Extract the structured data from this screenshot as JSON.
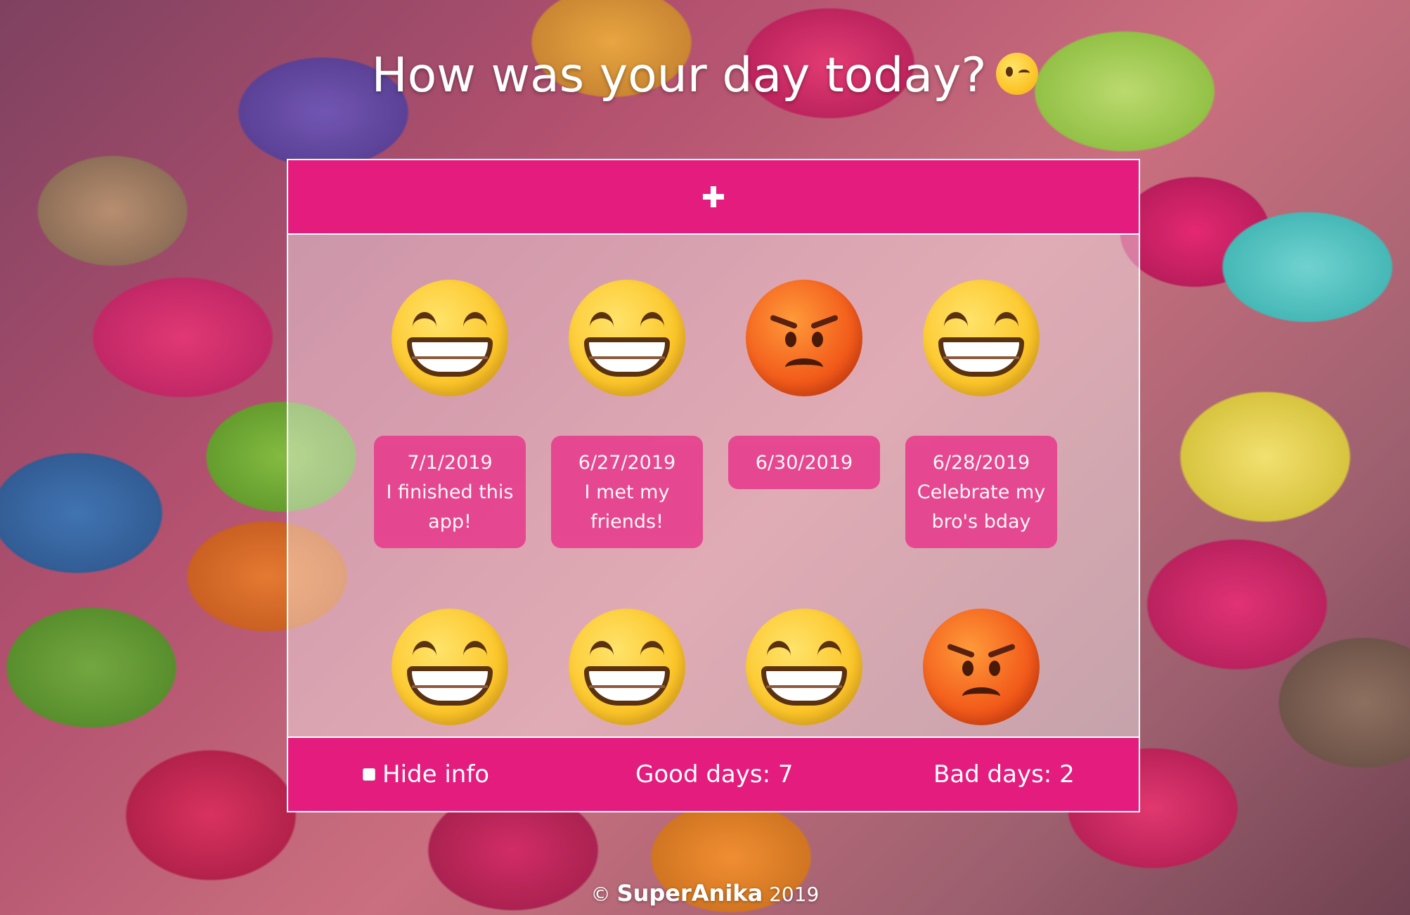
{
  "header": {
    "title": "How was your day today?",
    "title_icon": "wink-emoji-icon"
  },
  "add_button": {
    "icon": "plus-icon"
  },
  "days": [
    {
      "mood": "happy",
      "icon": "grinning-face-icon",
      "date": "7/1/2019",
      "note": "I finished this app!"
    },
    {
      "mood": "happy",
      "icon": "grinning-face-icon",
      "date": "6/27/2019",
      "note": "I met my friends!"
    },
    {
      "mood": "angry",
      "icon": "angry-face-icon",
      "date": "6/30/2019",
      "note": ""
    },
    {
      "mood": "happy",
      "icon": "grinning-face-icon",
      "date": "6/28/2019",
      "note": "Celebrate my bro's bday"
    },
    {
      "mood": "happy",
      "icon": "grinning-face-icon"
    },
    {
      "mood": "happy",
      "icon": "grinning-face-icon"
    },
    {
      "mood": "happy",
      "icon": "grinning-face-icon"
    },
    {
      "mood": "angry",
      "icon": "angry-face-icon"
    }
  ],
  "footer": {
    "hide_info_label": "Hide info",
    "hide_info_checked": false,
    "good_days": "Good days: 7",
    "bad_days": "Bad days: 2"
  },
  "copyright": {
    "symbol": "©",
    "brand": "SuperAnika",
    "year": "2019"
  },
  "colors": {
    "accent": "#e31c7e",
    "note_bg": "#e6408e",
    "panel_bg": "rgba(255,255,255,0.42)"
  }
}
